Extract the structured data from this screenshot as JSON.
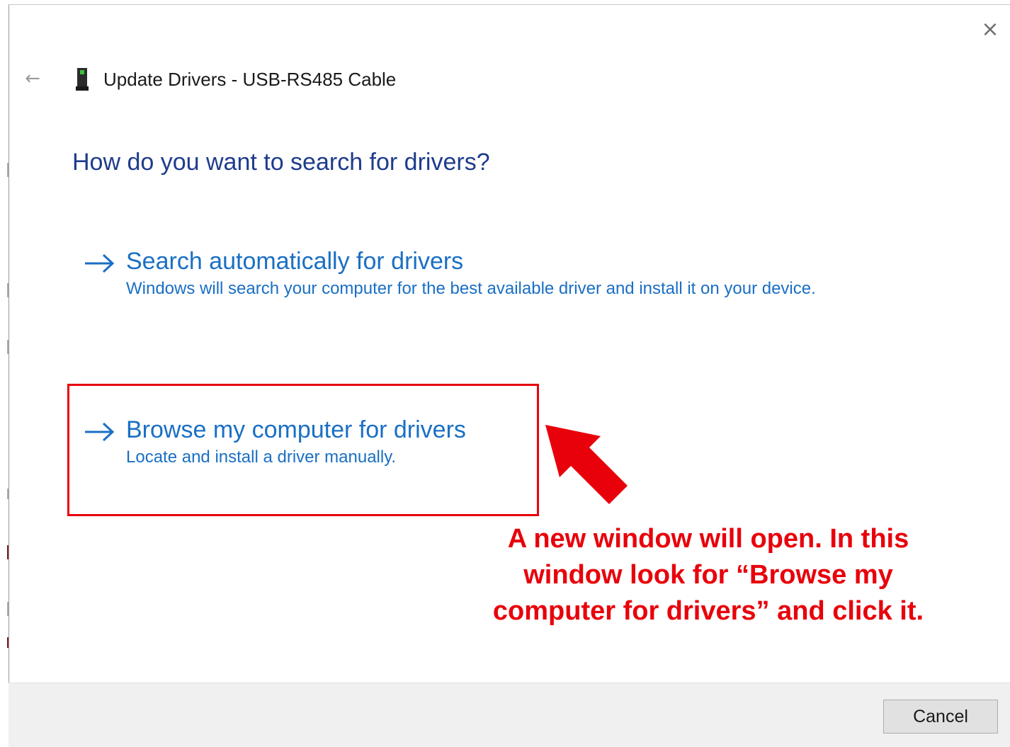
{
  "window": {
    "title": "Update Drivers - USB-RS485 Cable",
    "close_icon": "×",
    "back_icon": "←"
  },
  "main": {
    "heading": "How do you want to search for drivers?",
    "options": [
      {
        "title": "Search automatically for drivers",
        "description": "Windows will search your computer for the best available driver and install it on your device."
      },
      {
        "title": "Browse my computer for drivers",
        "description": "Locate and install a driver manually."
      }
    ]
  },
  "annotation": {
    "text": "A new window will open. In this window look for “Browse my computer for drivers” and click it.",
    "color": "#e8000b"
  },
  "footer": {
    "cancel_label": "Cancel"
  },
  "colors": {
    "link": "#1a6fc4",
    "heading": "#1e3c8c",
    "highlight": "#e8000b"
  }
}
